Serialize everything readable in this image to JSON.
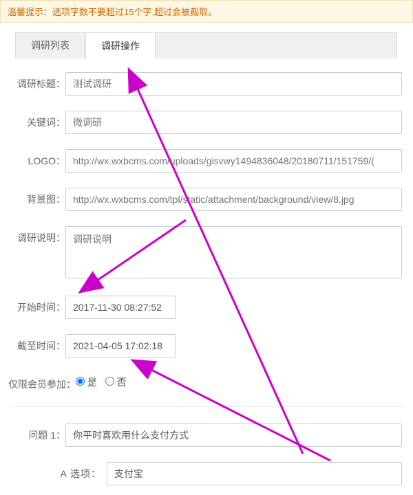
{
  "tip": "温馨提示：选项字数不要超过15个字,超过会被截取。",
  "tabs": {
    "list": "调研列表",
    "ops": "调研操作"
  },
  "labels": {
    "title": "调研标题：",
    "keyword": "关键词：",
    "logo": "LOGO：",
    "bg": "背景图：",
    "desc": "调研说明：",
    "start": "开始时间：",
    "end": "截至时间：",
    "member": "仅限会员参加：",
    "q1": "问题 1：",
    "optA": "A  选项："
  },
  "placeholders": {
    "title": "测试调研",
    "keyword": "微调研",
    "logo": "http://wx.wxbcms.com/uploads/gisvwy1494836048/20180711/151759/(",
    "bg": "http://wx.wxbcms.com/tpl/static/attachment/background/view/8.jpg",
    "desc": "调研说明"
  },
  "values": {
    "start": "2017-11-30 08:27:52",
    "end": "2021-04-05 17:02:18",
    "q1": "你平时喜欢用什么支付方式",
    "optA": "支付宝"
  },
  "radio": {
    "yes": "是",
    "no": "否"
  },
  "colors": {
    "arrow": "#cc00cc"
  }
}
